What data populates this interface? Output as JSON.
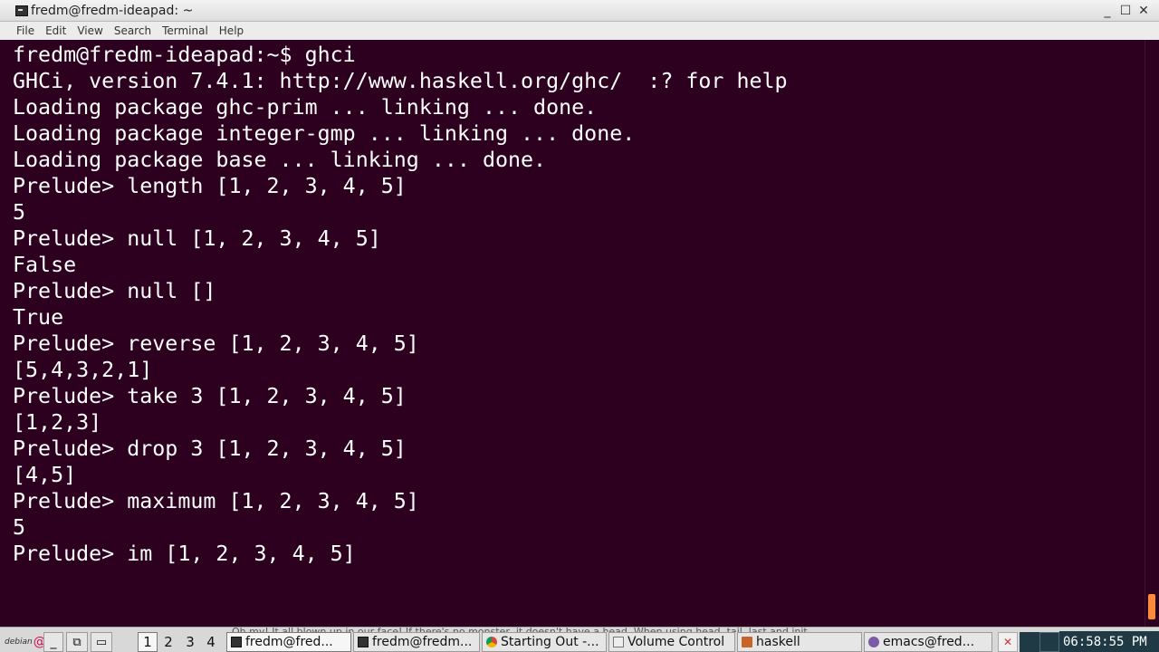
{
  "window": {
    "title": "fredm@fredm-ideapad: ~",
    "controls": {
      "minimize": "_",
      "maximize": "☐",
      "close": "✕"
    }
  },
  "menu": [
    "File",
    "Edit",
    "View",
    "Search",
    "Terminal",
    "Help"
  ],
  "terminal": {
    "lines": [
      "fredm@fredm-ideapad:~$ ghci",
      "GHCi, version 7.4.1: http://www.haskell.org/ghc/  :? for help",
      "Loading package ghc-prim ... linking ... done.",
      "Loading package integer-gmp ... linking ... done.",
      "Loading package base ... linking ... done.",
      "Prelude> length [1, 2, 3, 4, 5]",
      "5",
      "Prelude> null [1, 2, 3, 4, 5]",
      "False",
      "Prelude> null []",
      "True",
      "Prelude> reverse [1, 2, 3, 4, 5]",
      "[5,4,3,2,1]",
      "Prelude> take 3 [1, 2, 3, 4, 5]",
      "[1,2,3]",
      "Prelude> drop 3 [1, 2, 3, 4, 5]",
      "[4,5]",
      "Prelude> maximum [1, 2, 3, 4, 5]",
      "5",
      "Prelude> im [1, 2, 3, 4, 5]"
    ]
  },
  "taskbar": {
    "debian_label": "debian",
    "partial_text": "Oh my! It all blown up in our face! If there's no monster, it doesn't have a head. When using head, tail, last and init",
    "desktops": [
      "1",
      "2",
      "3",
      "4"
    ],
    "tasks": [
      {
        "label": "fredm@fred...",
        "icon": "terminal-icon"
      },
      {
        "label": "fredm@fredm...",
        "icon": "terminal-icon"
      },
      {
        "label": "Starting Out -...",
        "icon": "chrome-icon"
      },
      {
        "label": "Volume Control",
        "icon": "volume-icon"
      },
      {
        "label": "haskell",
        "icon": "folder-icon"
      },
      {
        "label": "emacs@fred...",
        "icon": "emacs-icon"
      }
    ],
    "clock": "06:58:55 PM"
  }
}
